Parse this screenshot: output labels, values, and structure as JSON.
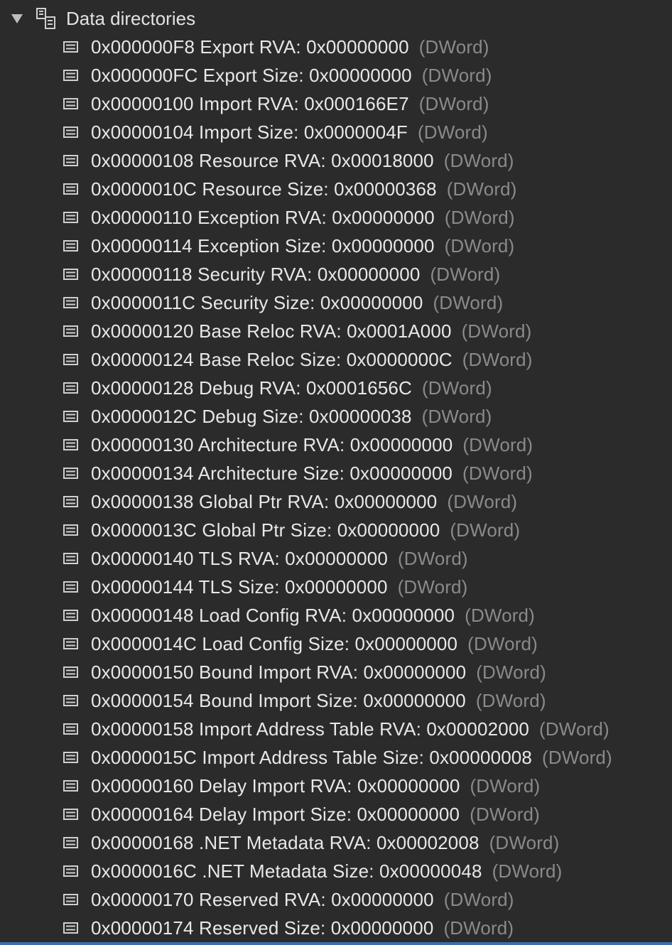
{
  "tree": {
    "header": {
      "label": "Data directories",
      "expanded": true,
      "toggle_icon": "triangle-down-icon",
      "node_icon": "struct-node-icon"
    },
    "row_icon": "field-icon",
    "rows": [
      {
        "text": "0x000000F8 Export RVA: 0x00000000",
        "type": "(DWord)"
      },
      {
        "text": "0x000000FC Export Size: 0x00000000",
        "type": "(DWord)"
      },
      {
        "text": "0x00000100 Import RVA: 0x000166E7",
        "type": "(DWord)"
      },
      {
        "text": "0x00000104 Import Size: 0x0000004F",
        "type": "(DWord)"
      },
      {
        "text": "0x00000108 Resource RVA: 0x00018000",
        "type": "(DWord)"
      },
      {
        "text": "0x0000010C Resource Size: 0x00000368",
        "type": "(DWord)"
      },
      {
        "text": "0x00000110 Exception RVA: 0x00000000",
        "type": "(DWord)"
      },
      {
        "text": "0x00000114 Exception Size: 0x00000000",
        "type": "(DWord)"
      },
      {
        "text": "0x00000118 Security RVA: 0x00000000",
        "type": "(DWord)"
      },
      {
        "text": "0x0000011C Security Size: 0x00000000",
        "type": "(DWord)"
      },
      {
        "text": "0x00000120 Base Reloc RVA: 0x0001A000",
        "type": "(DWord)"
      },
      {
        "text": "0x00000124 Base Reloc Size: 0x0000000C",
        "type": "(DWord)"
      },
      {
        "text": "0x00000128 Debug RVA: 0x0001656C",
        "type": "(DWord)"
      },
      {
        "text": "0x0000012C Debug Size: 0x00000038",
        "type": "(DWord)"
      },
      {
        "text": "0x00000130 Architecture RVA: 0x00000000",
        "type": "(DWord)"
      },
      {
        "text": "0x00000134 Architecture Size: 0x00000000",
        "type": "(DWord)"
      },
      {
        "text": "0x00000138 Global Ptr RVA: 0x00000000",
        "type": "(DWord)"
      },
      {
        "text": "0x0000013C Global Ptr Size: 0x00000000",
        "type": "(DWord)"
      },
      {
        "text": "0x00000140 TLS RVA: 0x00000000",
        "type": "(DWord)"
      },
      {
        "text": "0x00000144 TLS Size: 0x00000000",
        "type": "(DWord)"
      },
      {
        "text": "0x00000148 Load Config RVA: 0x00000000",
        "type": "(DWord)"
      },
      {
        "text": "0x0000014C Load Config Size: 0x00000000",
        "type": "(DWord)"
      },
      {
        "text": "0x00000150 Bound Import RVA: 0x00000000",
        "type": "(DWord)"
      },
      {
        "text": "0x00000154 Bound Import Size: 0x00000000",
        "type": "(DWord)"
      },
      {
        "text": "0x00000158 Import Address Table RVA: 0x00002000",
        "type": "(DWord)"
      },
      {
        "text": "0x0000015C Import Address Table Size: 0x00000008",
        "type": "(DWord)"
      },
      {
        "text": "0x00000160 Delay Import RVA: 0x00000000",
        "type": "(DWord)"
      },
      {
        "text": "0x00000164 Delay Import Size: 0x00000000",
        "type": "(DWord)"
      },
      {
        "text": "0x00000168 .NET Metadata RVA: 0x00002008",
        "type": "(DWord)"
      },
      {
        "text": "0x0000016C .NET Metadata Size: 0x00000048",
        "type": "(DWord)"
      },
      {
        "text": "0x00000170 Reserved RVA: 0x00000000",
        "type": "(DWord)"
      },
      {
        "text": "0x00000174 Reserved Size: 0x00000000",
        "type": "(DWord)"
      }
    ]
  },
  "colors": {
    "background": "#2b2b2b",
    "text": "#e8e8e8",
    "type_text": "#8a8a8a",
    "icon": "#cfcfcf",
    "accent_bar": "#3d6fa8"
  }
}
